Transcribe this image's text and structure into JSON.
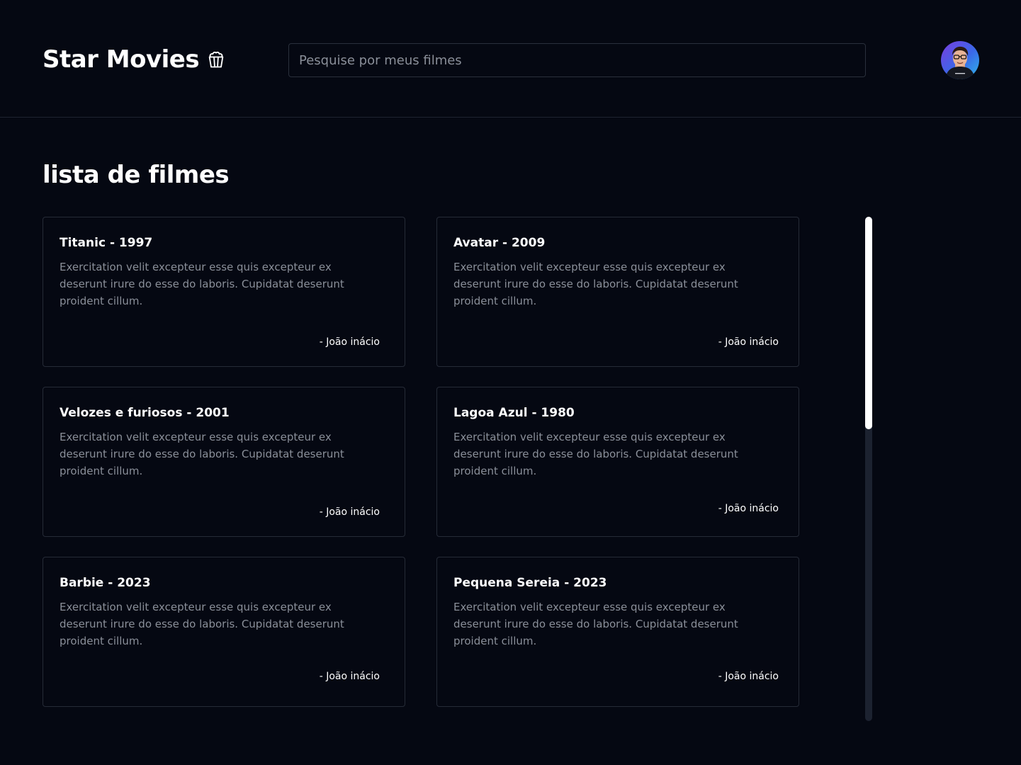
{
  "header": {
    "brand": "Star Movies",
    "brand_icon": "popcorn-icon",
    "search_placeholder": "Pesquise por meus filmes",
    "avatar_icon": "user-avatar"
  },
  "main": {
    "title": "lista de filmes",
    "movies": [
      {
        "title": "Titanic - 1997",
        "description": "Exercitation velit excepteur esse quis excepteur ex deserunt irure do esse do laboris. Cupidatat deserunt proident cillum.",
        "author": "- João inácio"
      },
      {
        "title": "Avatar - 2009",
        "description": "Exercitation velit excepteur esse quis excepteur ex deserunt irure do esse do laboris. Cupidatat deserunt proident cillum.",
        "author": "- João inácio"
      },
      {
        "title": "Velozes e furiosos - 2001",
        "description": "Exercitation velit excepteur esse quis excepteur ex deserunt irure do esse do laboris. Cupidatat deserunt proident cillum.",
        "author": "- João inácio"
      },
      {
        "title": "Lagoa Azul - 1980",
        "description": "Exercitation velit excepteur esse quis excepteur ex deserunt irure do esse do laboris. Cupidatat deserunt proident cillum.",
        "author": "- João inácio"
      },
      {
        "title": "Barbie - 2023",
        "description": "Exercitation velit excepteur esse quis excepteur ex deserunt irure do esse do laboris. Cupidatat deserunt proident cillum.",
        "author": "- João inácio"
      },
      {
        "title": "Pequena Sereia - 2023",
        "description": "Exercitation velit excepteur esse quis excepteur ex deserunt irure do esse do laboris. Cupidatat deserunt proident cillum.",
        "author": "- João inácio"
      }
    ]
  },
  "colors": {
    "background": "#050812",
    "border": "#262b37",
    "text_muted": "#8a8f99",
    "scroll_track": "#1c2230",
    "scroll_thumb": "#ffffff"
  }
}
